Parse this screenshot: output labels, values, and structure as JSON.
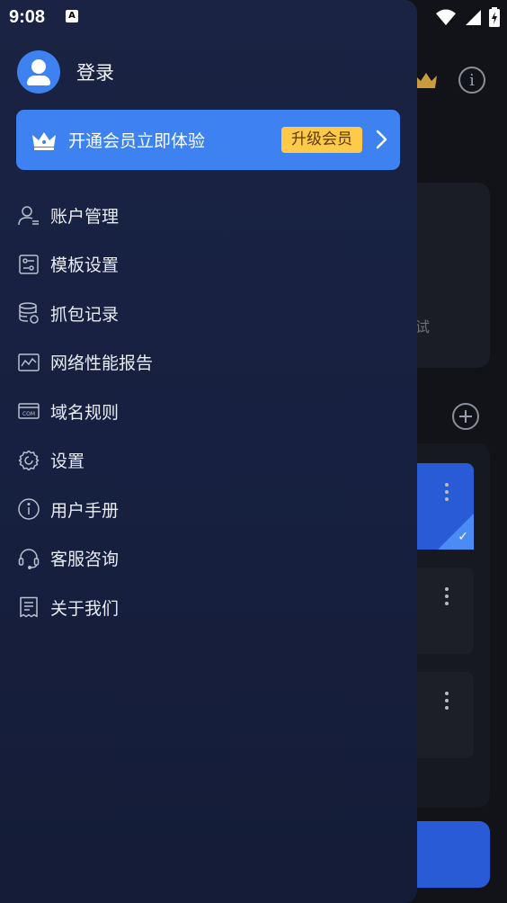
{
  "status_bar": {
    "time": "9:08",
    "notification_icon": "A"
  },
  "background": {
    "partial_text": "试",
    "check_mark": "✓"
  },
  "drawer": {
    "login_label": "登录",
    "vip": {
      "text": "开通会员立即体验",
      "button_label": "升级会员"
    },
    "menu": [
      {
        "label": "账户管理",
        "icon": "account-icon"
      },
      {
        "label": "模板设置",
        "icon": "template-icon"
      },
      {
        "label": "抓包记录",
        "icon": "database-icon"
      },
      {
        "label": "网络性能报告",
        "icon": "chart-icon"
      },
      {
        "label": "域名规则",
        "icon": "domain-icon"
      },
      {
        "label": "设置",
        "icon": "gear-icon"
      },
      {
        "label": "用户手册",
        "icon": "info-icon"
      },
      {
        "label": "客服咨询",
        "icon": "headset-icon"
      },
      {
        "label": "关于我们",
        "icon": "receipt-icon"
      }
    ]
  },
  "colors": {
    "accent": "#3d82f0",
    "vip_button": "#ffc94a",
    "drawer_bg": "#1a2343"
  }
}
